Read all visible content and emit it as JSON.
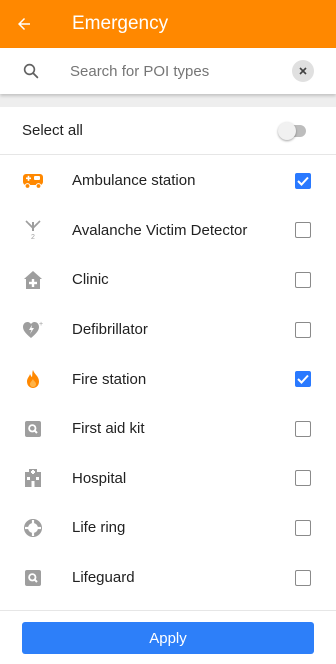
{
  "header": {
    "title": "Emergency",
    "back_icon": "arrow-back-icon",
    "color": "#ff8800"
  },
  "search": {
    "placeholder": "Search for POI types",
    "icon": "search-icon",
    "clear_icon": "close-icon"
  },
  "select_all": {
    "label": "Select all",
    "enabled": false
  },
  "items": [
    {
      "label": "Ambulance station",
      "icon": "ambulance-icon",
      "checked": true
    },
    {
      "label": "Avalanche Victim Detector",
      "icon": "avalanche-detector-icon",
      "checked": false
    },
    {
      "label": "Clinic",
      "icon": "clinic-icon",
      "checked": false
    },
    {
      "label": "Defibrillator",
      "icon": "defibrillator-icon",
      "checked": false
    },
    {
      "label": "Fire station",
      "icon": "fire-station-icon",
      "checked": true
    },
    {
      "label": "First aid kit",
      "icon": "first-aid-kit-icon",
      "checked": false
    },
    {
      "label": "Hospital",
      "icon": "hospital-icon",
      "checked": false
    },
    {
      "label": "Life ring",
      "icon": "life-ring-icon",
      "checked": false
    },
    {
      "label": "Lifeguard",
      "icon": "lifeguard-icon",
      "checked": false
    }
  ],
  "footer": {
    "apply_label": "Apply",
    "button_color": "#2d7ff9"
  },
  "colors": {
    "checkbox_checked": "#2979ff",
    "orange_accent": "#ff8800",
    "icon_grey": "#9e9e9e"
  }
}
